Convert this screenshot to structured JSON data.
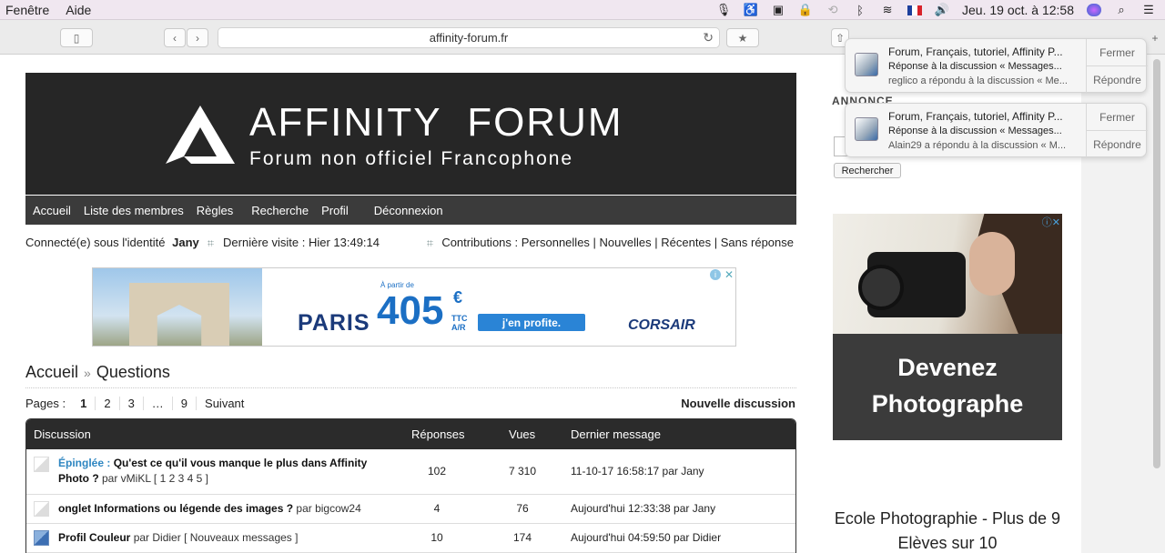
{
  "menubar": {
    "items": [
      "Fenêtre",
      "Aide"
    ],
    "clock": "Jeu. 19 oct. à 12:58"
  },
  "browser": {
    "url": "affinity-forum.fr"
  },
  "site": {
    "title": "AFFINITY  FORUM",
    "subtitle": "Forum non officiel Francophone",
    "nav": [
      "Accueil",
      "Liste des membres",
      "Règles",
      "Recherche",
      "Profil",
      "Déconnexion"
    ],
    "user_label": "Connecté(e) sous l'identité",
    "username": "Jany",
    "last_visit": "Dernière visite : Hier 13:49:14",
    "contrib_label": "Contributions :",
    "contrib_links": [
      "Personnelles",
      "Nouvelles",
      "Récentes",
      "Sans réponse"
    ]
  },
  "ad_banner": {
    "from": "À partir de",
    "city": "PARIS",
    "price": "405",
    "currency": "€",
    "ttc": "TTC",
    "ar": "A/R",
    "cta": "j'en profite.",
    "brand": "CORSAIR"
  },
  "breadcrumb": {
    "home": "Accueil",
    "current": "Questions"
  },
  "pagination": {
    "label": "Pages :",
    "pages": [
      "1",
      "2",
      "3",
      "…",
      "9",
      "Suivant"
    ],
    "new_topic": "Nouvelle discussion"
  },
  "table": {
    "headers": {
      "discussion": "Discussion",
      "replies": "Réponses",
      "views": "Vues",
      "last": "Dernier message"
    },
    "rows": [
      {
        "prefix": "Épinglée :",
        "title": "Qu'est ce qu'il vous manque le plus dans Affinity Photo ?",
        "by": "par vMiKL",
        "pages": "[ 1 2 3 4 5 ]",
        "replies": "102",
        "views": "7 310",
        "last": "11-10-17 16:58:17 par Jany"
      },
      {
        "prefix": "",
        "title": "onglet Informations ou légende des images ?",
        "by": "par bigcow24",
        "pages": "",
        "replies": "4",
        "views": "76",
        "last": "Aujourd'hui 12:33:38 par Jany"
      },
      {
        "prefix": "",
        "title": "Profil Couleur",
        "by": "par Didier",
        "pages": "[ Nouveaux messages ]",
        "replies": "10",
        "views": "174",
        "last": "Aujourd'hui 04:59:50 par Didier"
      }
    ]
  },
  "sidebar": {
    "annonce": "ANNONCE",
    "search_button": "Rechercher",
    "ad_line1": "Devenez",
    "ad_line2": "Photographe",
    "ad_text": "Ecole Photographie - Plus de 9 Elèves sur 10"
  },
  "notifications": [
    {
      "title": "Forum, Français, tutoriel, Affinity P...",
      "line1": "Réponse à la discussion « Messages...",
      "line2": "reglico a répondu à la discussion « Me...",
      "close": "Fermer",
      "reply": "Répondre"
    },
    {
      "title": "Forum, Français, tutoriel, Affinity P...",
      "line1": "Réponse à la discussion « Messages...",
      "line2": "Alain29 a répondu à la discussion « M...",
      "close": "Fermer",
      "reply": "Répondre"
    }
  ]
}
